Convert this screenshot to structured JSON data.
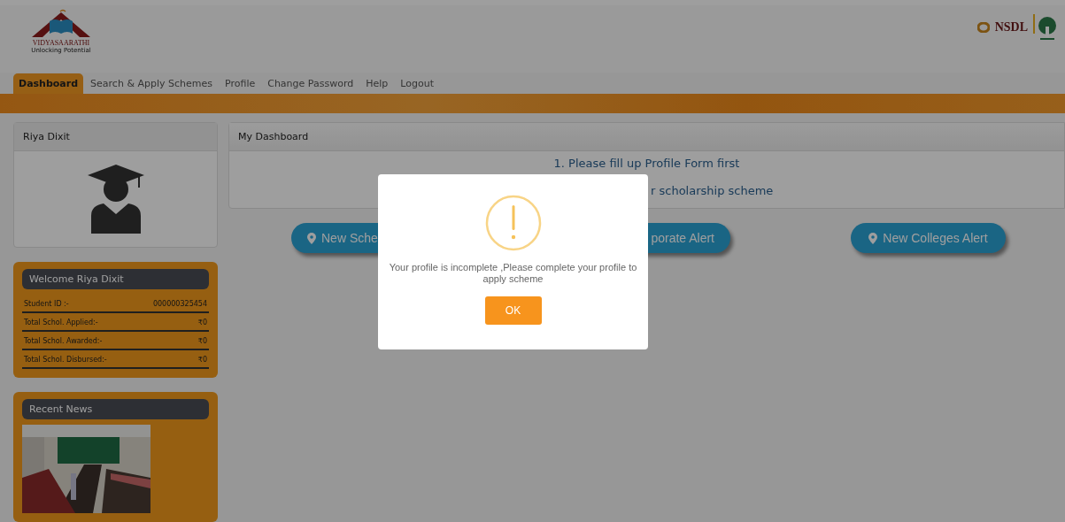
{
  "header": {
    "logo_name": "VIDYASAARATHI",
    "logo_tagline": "Unlocking Potential",
    "partner_logo": "NSDL"
  },
  "nav": [
    {
      "label": "Dashboard",
      "selected": true
    },
    {
      "label": "Search & Apply Schemes",
      "selected": false
    },
    {
      "label": "Profile",
      "selected": false
    },
    {
      "label": "Change Password",
      "selected": false
    },
    {
      "label": "Help",
      "selected": false
    },
    {
      "label": "Logout",
      "selected": false
    }
  ],
  "profile_card": {
    "title": "Riya Dixit"
  },
  "welcome_card": {
    "title": "Welcome Riya Dixit",
    "rows": [
      {
        "label": "Student ID :-",
        "value": "000000325454"
      },
      {
        "label": "Total Schol. Applied:-",
        "value": "₹0"
      },
      {
        "label": "Total Schol. Awarded:-",
        "value": "₹0"
      },
      {
        "label": "Total Schol. Disbursed:-",
        "value": "₹0"
      }
    ]
  },
  "news_card": {
    "title": "Recent News"
  },
  "dashboard": {
    "title": "My Dashboard",
    "messages": [
      "1. Please fill up Profile Form first",
      "r scholarship scheme"
    ],
    "alerts": [
      "New Sche",
      "porate Alert",
      "New Colleges Alert"
    ]
  },
  "dialog": {
    "message": "Your profile is incomplete ,Please complete your profile to apply scheme",
    "button": "OK"
  }
}
